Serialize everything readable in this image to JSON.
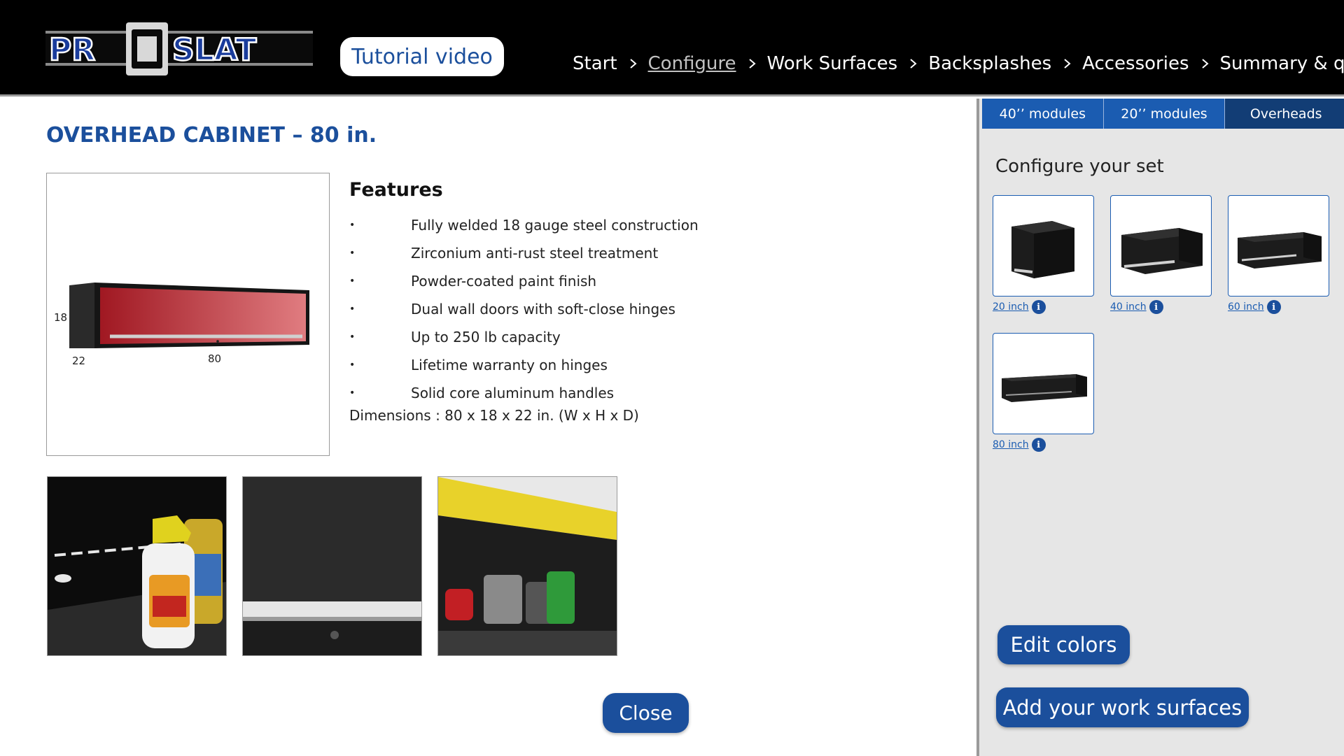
{
  "header": {
    "logo_text": "PROSLAT",
    "tutorial_label": "Tutorial video",
    "breadcrumb": [
      {
        "label": "Start"
      },
      {
        "label": "Configure"
      },
      {
        "label": "Work Surfaces"
      },
      {
        "label": "Backsplashes"
      },
      {
        "label": "Accessories"
      },
      {
        "label": "Summary & quote"
      }
    ],
    "active_step": "Configure"
  },
  "product": {
    "title": "OVERHEAD CABINET – 80 in.",
    "diagram": {
      "height": "18",
      "depth": "22",
      "width": "80"
    },
    "features_title": "Features",
    "features": [
      "Fully welded 18 gauge steel construction",
      "Zirconium anti-rust steel treatment",
      "Powder-coated paint finish",
      "Dual wall doors  with soft-close hinges",
      "Up to 250 lb capacity",
      "Lifetime warranty on hinges",
      "Solid core aluminum handles"
    ],
    "dimensions": "Dimensions : 80 x 18 x 22 in. (W x H x D)",
    "cabinet_color": "#b5202a"
  },
  "close_label": "Close",
  "panel": {
    "tabs": [
      "40’’ modules",
      "20’’ modules",
      "Overheads"
    ],
    "selected_tab": "Overheads",
    "title": "Configure your set",
    "options": [
      {
        "label": "20 inch"
      },
      {
        "label": "40 inch"
      },
      {
        "label": "60 inch"
      },
      {
        "label": "80 inch"
      }
    ],
    "info_glyph": "i",
    "edit_colors_label": "Edit colors",
    "add_surfaces_label": "Add your work surfaces"
  },
  "colors": {
    "brand_blue": "#1b4f9c",
    "tab_blue": "#1b5cb1",
    "panel_bg": "#e6e6e6"
  }
}
